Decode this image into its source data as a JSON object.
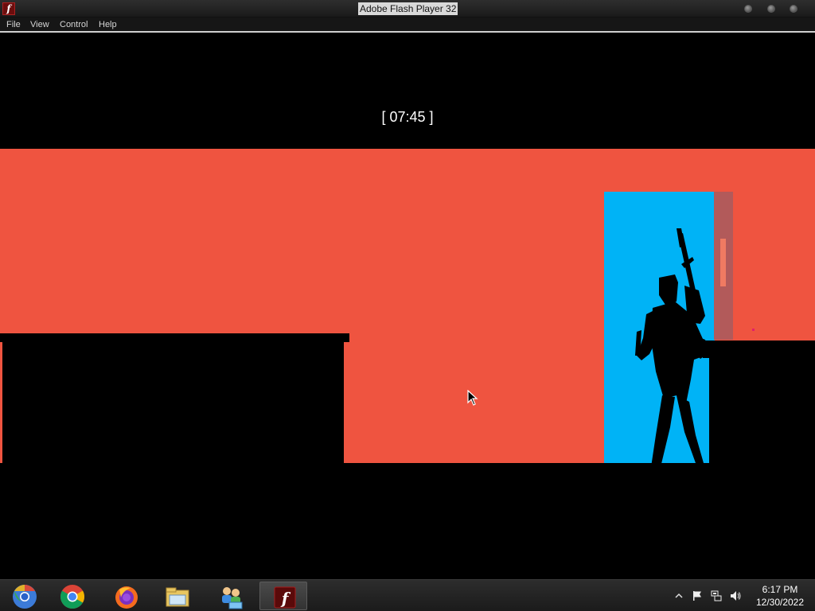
{
  "window": {
    "title": "Adobe Flash Player 32",
    "app_icon": "flash-icon"
  },
  "menu": [
    {
      "label": "File"
    },
    {
      "label": "View"
    },
    {
      "label": "Control"
    },
    {
      "label": "Help"
    }
  ],
  "game": {
    "timer": "[ 07:45 ]",
    "colors": {
      "wall": "#ef5440",
      "door": "#00b3f6",
      "silhouette": "#000000"
    }
  },
  "taskbar": {
    "apps": [
      {
        "icon": "chromium-icon",
        "active": false
      },
      {
        "icon": "chrome-icon",
        "active": false
      },
      {
        "icon": "firefox-icon",
        "active": false
      },
      {
        "icon": "file-explorer-icon",
        "active": false
      },
      {
        "icon": "network-sharing-icon",
        "active": false
      },
      {
        "icon": "flash-player-icon",
        "active": true
      }
    ],
    "tray": [
      {
        "icon": "show-hidden-icons-icon"
      },
      {
        "icon": "action-center-flag-icon"
      },
      {
        "icon": "network-icon"
      },
      {
        "icon": "volume-icon"
      }
    ],
    "clock": {
      "time": "6:17 PM",
      "date": "12/30/2022"
    }
  }
}
